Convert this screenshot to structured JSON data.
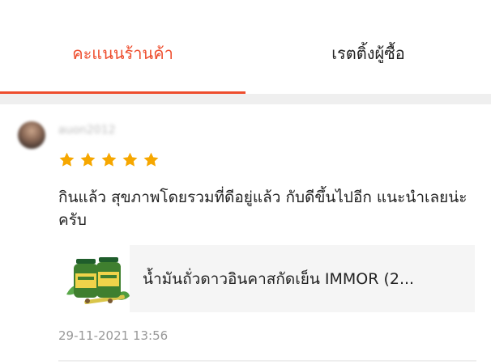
{
  "tabs": [
    {
      "label": "คะแนนร้านค้า",
      "active": true
    },
    {
      "label": "เรตติ้งผู้ซื้อ",
      "active": false
    }
  ],
  "colors": {
    "accent": "#ee4d2d",
    "star": "#f6a700",
    "muted_text": "#999999",
    "card_bg": "#f5f5f5",
    "band_bg": "#efefef"
  },
  "review": {
    "username": "auon2012",
    "rating": 5,
    "rating_max": 5,
    "comment": "กินแล้ว สุขภาพโดยรวมที่ดีอยู่แล้ว กับดีขึ้นไปอีก แนะนำเลยน่ะครับ",
    "product": {
      "title": "น้ำมันถั่วดาวอินคาสกัดเย็น IMMOR (2..."
    },
    "timestamp": "29-11-2021 13:56"
  }
}
